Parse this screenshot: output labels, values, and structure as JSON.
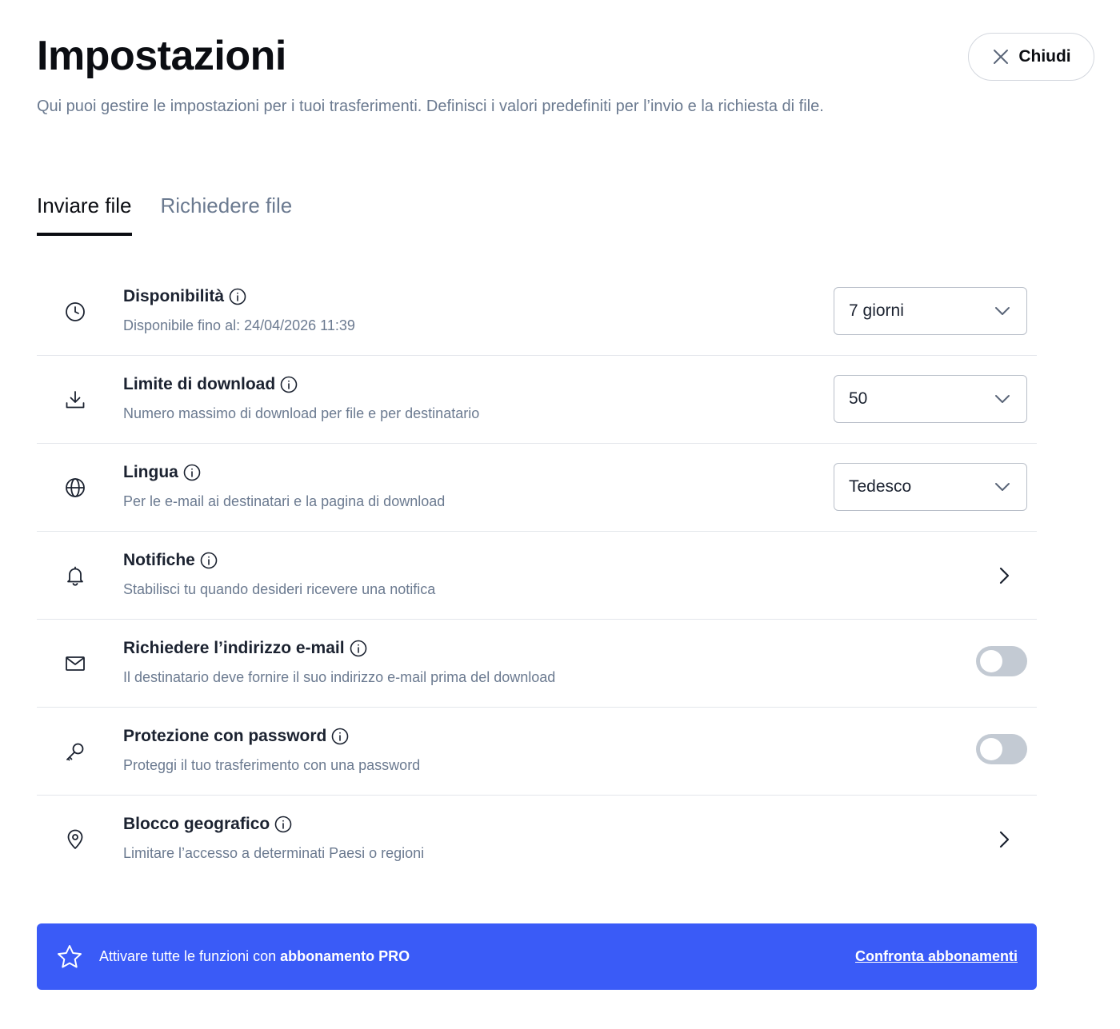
{
  "header": {
    "title": "Impostazioni",
    "description": "Qui puoi gestire le impostazioni per i tuoi trasferimenti. Definisci i valori predefiniti per l’invio e la richiesta di file.",
    "close_label": "Chiudi"
  },
  "tabs": [
    {
      "label": "Inviare file",
      "active": true
    },
    {
      "label": "Richiedere file",
      "active": false
    }
  ],
  "settings": [
    {
      "icon": "clock-icon",
      "title": "Disponibilità",
      "subtitle": "Disponibile fino al: 24/04/2026 11:39",
      "control": "select",
      "value": "7 giorni"
    },
    {
      "icon": "download-icon",
      "title": "Limite di download",
      "subtitle": "Numero massimo di download per file e per destinatario",
      "control": "select",
      "value": "50"
    },
    {
      "icon": "globe-icon",
      "title": "Lingua",
      "subtitle": "Per le e-mail ai destinatari e la pagina di download",
      "control": "select",
      "value": "Tedesco"
    },
    {
      "icon": "bell-icon",
      "title": "Notifiche",
      "subtitle": "Stabilisci tu quando desideri ricevere una notifica",
      "control": "chevron"
    },
    {
      "icon": "envelope-icon",
      "title": "Richiedere l’indirizzo e-mail",
      "subtitle": "Il destinatario deve fornire il suo indirizzo e-mail prima del download",
      "control": "toggle",
      "enabled": false
    },
    {
      "icon": "key-icon",
      "title": "Protezione con password",
      "subtitle": "Proteggi il tuo trasferimento con una password",
      "control": "toggle",
      "enabled": false
    },
    {
      "icon": "map-pin-icon",
      "title": "Blocco geografico",
      "subtitle": "Limitare l’accesso a determinati Paesi o regioni",
      "control": "chevron"
    }
  ],
  "promo": {
    "text_prefix": "Attivare tutte le funzioni con ",
    "text_bold": "abbonamento PRO",
    "link_label": "Confronta abbonamenti"
  },
  "colors": {
    "accent": "#3a5bf7",
    "muted_text": "#6b7a90",
    "toggle_off": "#c3cad3"
  }
}
